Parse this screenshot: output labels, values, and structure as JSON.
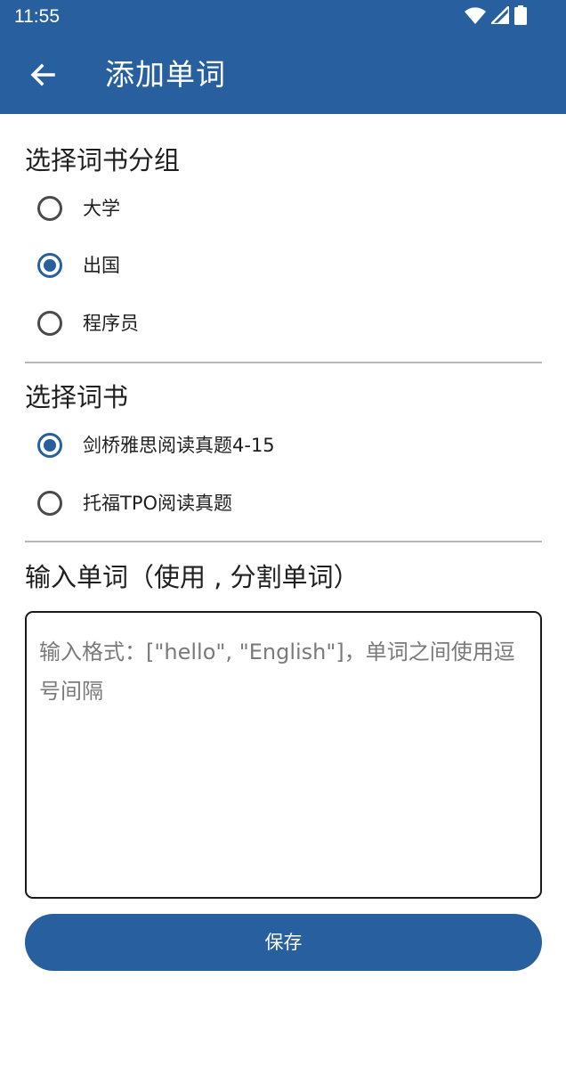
{
  "status_bar": {
    "time": "11:55",
    "icons": [
      "wifi-icon",
      "cellular-signal-icon",
      "battery-icon"
    ]
  },
  "app_bar": {
    "back_icon": "arrow-left-icon",
    "title": "添加单词"
  },
  "group_section": {
    "title": "选择词书分组",
    "options": [
      {
        "label": "大学",
        "selected": false
      },
      {
        "label": "出国",
        "selected": true
      },
      {
        "label": "程序员",
        "selected": false
      }
    ]
  },
  "book_section": {
    "title": "选择词书",
    "options": [
      {
        "label": "剑桥雅思阅读真题4-15",
        "selected": true
      },
      {
        "label": "托福TPO阅读真题",
        "selected": false
      }
    ]
  },
  "input_section": {
    "title": "输入单词（使用 , 分割单词）",
    "value": "",
    "placeholder": "输入格式：[\"hello\", \"English\"]，单词之间使用逗号间隔"
  },
  "save_label": "保存",
  "colors": {
    "primary": "#28609F",
    "radio_unchecked": "#4a4a4a",
    "divider": "#b8b8b8",
    "placeholder": "#7a7a7a"
  }
}
